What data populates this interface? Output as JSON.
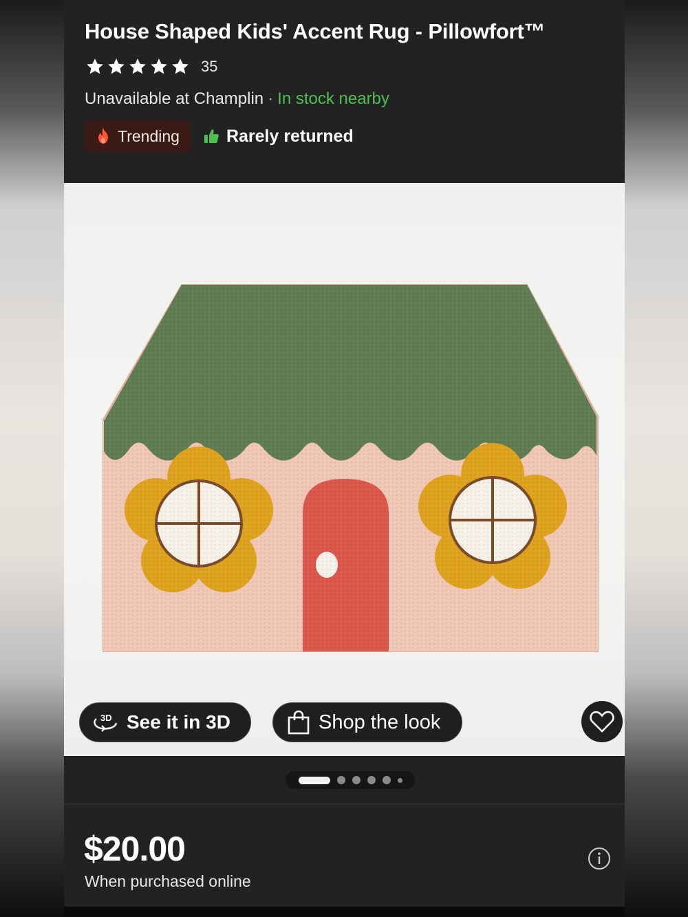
{
  "product": {
    "title": "House Shaped Kids' Accent Rug - Pillowfort™",
    "rating": {
      "stars": 5,
      "count": "35"
    },
    "availability": {
      "store_status": "Unavailable at Champlin",
      "separator": "·",
      "nearby_status": "In stock nearby",
      "nearby_color": "#4fbf4f"
    },
    "badges": {
      "trending": {
        "label": "Trending",
        "icon": "flame-icon"
      },
      "returned": {
        "label": "Rarely returned",
        "icon": "thumbs-up-icon"
      }
    }
  },
  "gallery": {
    "see_3d_label": "See it in 3D",
    "see_3d_icon": "3d-rotate-icon",
    "shop_look_label": "Shop the look",
    "shop_look_icon": "shopping-bag-icon",
    "favorite_icon": "heart-icon",
    "image_count": 6,
    "active_index": 0
  },
  "pricing": {
    "price": "$20.00",
    "note": "When purchased online",
    "info_icon": "info-icon"
  },
  "colors": {
    "background": "#222222",
    "in_stock_green": "#4fbf4f",
    "rug_roof": "#5f7c52",
    "rug_wall": "#f0c4b4",
    "rug_flower": "#dfa21e",
    "rug_door": "#d9574b"
  }
}
